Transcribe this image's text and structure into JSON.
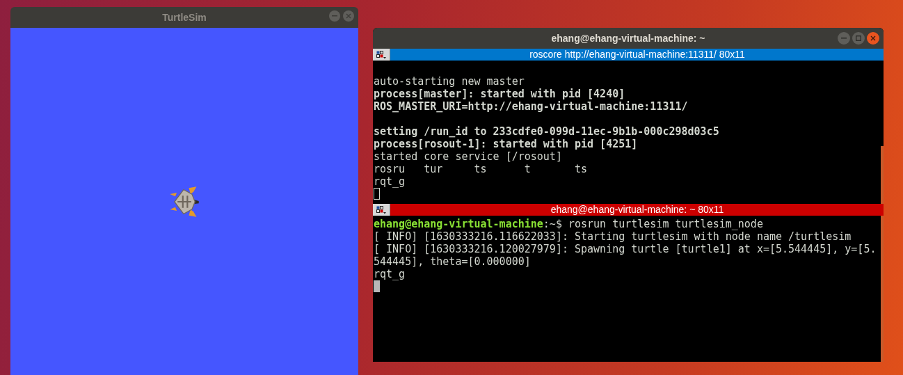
{
  "turtlesim_window": {
    "title": "TurtleSim"
  },
  "terminal_window": {
    "title": "ehang@ehang-virtual-machine: ~",
    "panes": [
      {
        "header": "roscore http://ehang-virtual-machine:11311/ 80x11",
        "color": "#0077cc",
        "focused": false,
        "lines": [
          {
            "kind": "blank"
          },
          {
            "text": "auto-starting new master",
            "bold": false
          },
          {
            "text": "process[master]: started with pid [4240]",
            "bold": true
          },
          {
            "text": "ROS_MASTER_URI=http://ehang-virtual-machine:11311/",
            "bold": true
          },
          {
            "kind": "blank"
          },
          {
            "text": "setting /run_id to 233cdfe0-099d-11ec-9b1b-000c298d03c5",
            "bold": true
          },
          {
            "text": "process[rosout-1]: started with pid [4251]",
            "bold": true
          },
          {
            "text": "started core service [/rosout]",
            "bold": false
          },
          {
            "text": "rosru   tur     ts      t       ts",
            "bold": false
          },
          {
            "text": "rqt_g",
            "bold": false
          }
        ]
      },
      {
        "header": "ehang@ehang-virtual-machine: ~ 80x11",
        "color": "#cc0000",
        "focused": true,
        "lines": [
          {
            "kind": "prompt",
            "user": "ehang@ehang-virtual-machine",
            "text": ":~$ rosrun turtlesim turtlesim_node"
          },
          {
            "text": "[ INFO] [1630333216.116622033]: Starting turtlesim with node name /turtlesim",
            "bold": false
          },
          {
            "text": "[ INFO] [1630333216.120027979]: Spawning turtle [turtle1] at x=[5.544445], y=[5.",
            "bold": false
          },
          {
            "text": "544445], theta=[0.000000]",
            "bold": false
          },
          {
            "text": "rqt_g",
            "bold": false
          }
        ]
      }
    ]
  }
}
